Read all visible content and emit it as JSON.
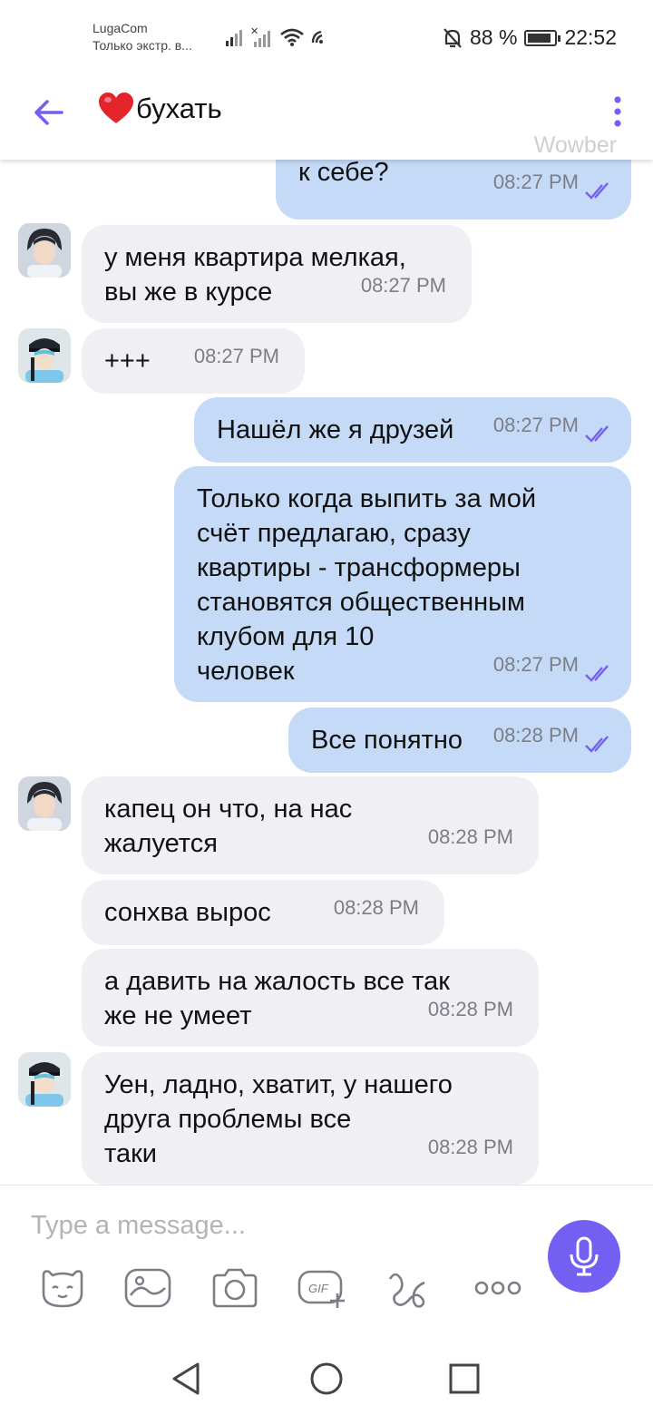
{
  "status_bar": {
    "carrier_line1": "LugaCom",
    "carrier_line2": "Только экстр. в...",
    "battery": "88 %",
    "battery_level": 0.88,
    "time": "22:52",
    "icons": [
      "signal-icon",
      "signal-x-icon",
      "wifi-icon",
      "nfc-icon",
      "mute-icon",
      "battery-icon"
    ]
  },
  "header": {
    "title_emoji": "❤️",
    "title": "бухать",
    "watermark": "Wowber",
    "back_icon": "arrow-left-icon",
    "menu_icon": "kebab-icon",
    "accent_color": "#7360f2"
  },
  "messages": [
    {
      "direction": "out",
      "text": "Можете меня пустить\nк себе?",
      "time": "08:27 PM",
      "status": "read"
    },
    {
      "direction": "in",
      "avatar": "avatar-1",
      "text": "у меня квартира мелкая,\nвы же в курсе",
      "time": "08:27 PM"
    },
    {
      "direction": "in",
      "avatar": "avatar-2",
      "text": "+++",
      "time": "08:27 PM"
    },
    {
      "direction": "out",
      "text": "Нашёл же я друзей",
      "time": "08:27 PM",
      "status": "read"
    },
    {
      "direction": "out",
      "text": "Только когда выпить за мой\nсчёт предлагаю, сразу\nквартиры - трансформеры\nстановятся общественным\nклубом для 10\nчеловек",
      "time": "08:27 PM",
      "status": "read"
    },
    {
      "direction": "out",
      "text": "Все понятно",
      "time": "08:28 PM",
      "status": "read"
    },
    {
      "direction": "in",
      "avatar": "avatar-1",
      "text": "капец он что, на нас\nжалуется",
      "time": "08:28 PM"
    },
    {
      "direction": "in",
      "text": "сонхва вырос",
      "time": "08:28 PM"
    },
    {
      "direction": "in",
      "text": "а давить на жалость все так\nже не умеет",
      "time": "08:28 PM"
    },
    {
      "direction": "in",
      "avatar": "avatar-2",
      "text": "Уен, ладно, хватит, у нашего\nдруга проблемы все\nтаки",
      "time": "08:28 PM"
    }
  ],
  "composer": {
    "placeholder": "Type a message...",
    "tools": [
      "sticker-icon",
      "gallery-icon",
      "camera-icon",
      "gif-icon",
      "doodle-icon",
      "more-icon"
    ],
    "mic_icon": "microphone-icon"
  },
  "nav": [
    "back-triangle-icon",
    "home-circle-icon",
    "recents-square-icon"
  ],
  "colors": {
    "incoming_bubble": "#f0eff3",
    "outgoing_bubble": "#c5daf6",
    "read_ticks": "#7360f2"
  }
}
